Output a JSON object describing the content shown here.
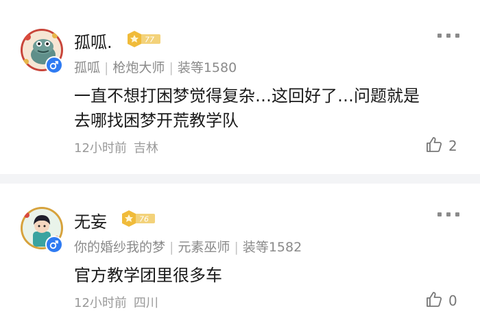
{
  "comments": [
    {
      "username": "孤呱.",
      "level_badge": "77",
      "meta": {
        "server": "孤呱",
        "class": "枪炮大师",
        "gear": "装等1580"
      },
      "text": "一直不想打困梦觉得复杂…这回好了…问题就是去哪找困梦开荒教学队",
      "time": "12小时前",
      "location": "吉林",
      "likes": "2",
      "icons": [
        "avatar-frog",
        "male-icon",
        "level-badge-icon",
        "more-icon",
        "thumbs-up-icon"
      ]
    },
    {
      "username": "无妄",
      "level_badge": "76",
      "meta": {
        "server": "你的婚纱我的梦",
        "class": "元素巫师",
        "gear": "装等1582"
      },
      "text": "官方教学团里很多车",
      "time": "12小时前",
      "location": "四川",
      "likes": "0",
      "icons": [
        "avatar-character",
        "male-icon",
        "level-badge-icon",
        "more-icon",
        "thumbs-up-icon"
      ]
    }
  ],
  "colors": {
    "gender_badge": "#2f7bf2",
    "level_badge": "#f2c44d",
    "divider": "#f3f4f6"
  }
}
